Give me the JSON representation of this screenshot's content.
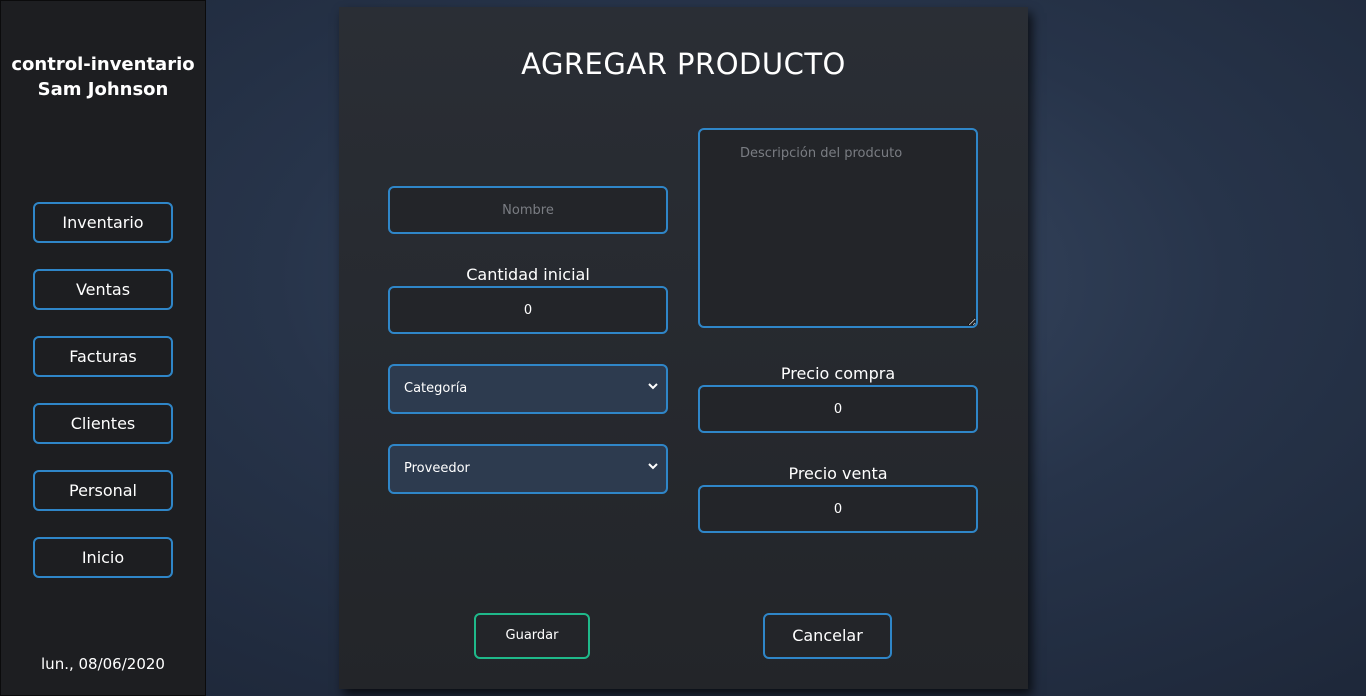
{
  "sidebar": {
    "app_name": "control-inventario",
    "user_name": "Sam Johnson",
    "nav": {
      "inventario": "Inventario",
      "ventas": "Ventas",
      "facturas": "Facturas",
      "clientes": "Clientes",
      "personal": "Personal",
      "inicio": "Inicio"
    },
    "date": "lun., 08/06/2020"
  },
  "form": {
    "title": "AGREGAR PRODUCTO",
    "nombre_placeholder": "Nombre",
    "descripcion_placeholder": "Descripción del prodcuto",
    "cantidad_label": "Cantidad inicial",
    "cantidad_value": "0",
    "categoria_selected": "Categoría",
    "proveedor_selected": "Proveedor",
    "precio_compra_label": "Precio compra",
    "precio_compra_value": "0",
    "precio_venta_label": "Precio venta",
    "precio_venta_value": "0",
    "guardar_label": "Guardar",
    "cancelar_label": "Cancelar"
  },
  "colors": {
    "accent_border": "#2f86c8",
    "save_border": "#1fb98a",
    "select_bg": "#2d3b4f",
    "sidebar_bg": "#1d1e21",
    "panel_bg": "#2a2e35"
  },
  "icons": {
    "select_arrow": "chevron-down-icon"
  }
}
